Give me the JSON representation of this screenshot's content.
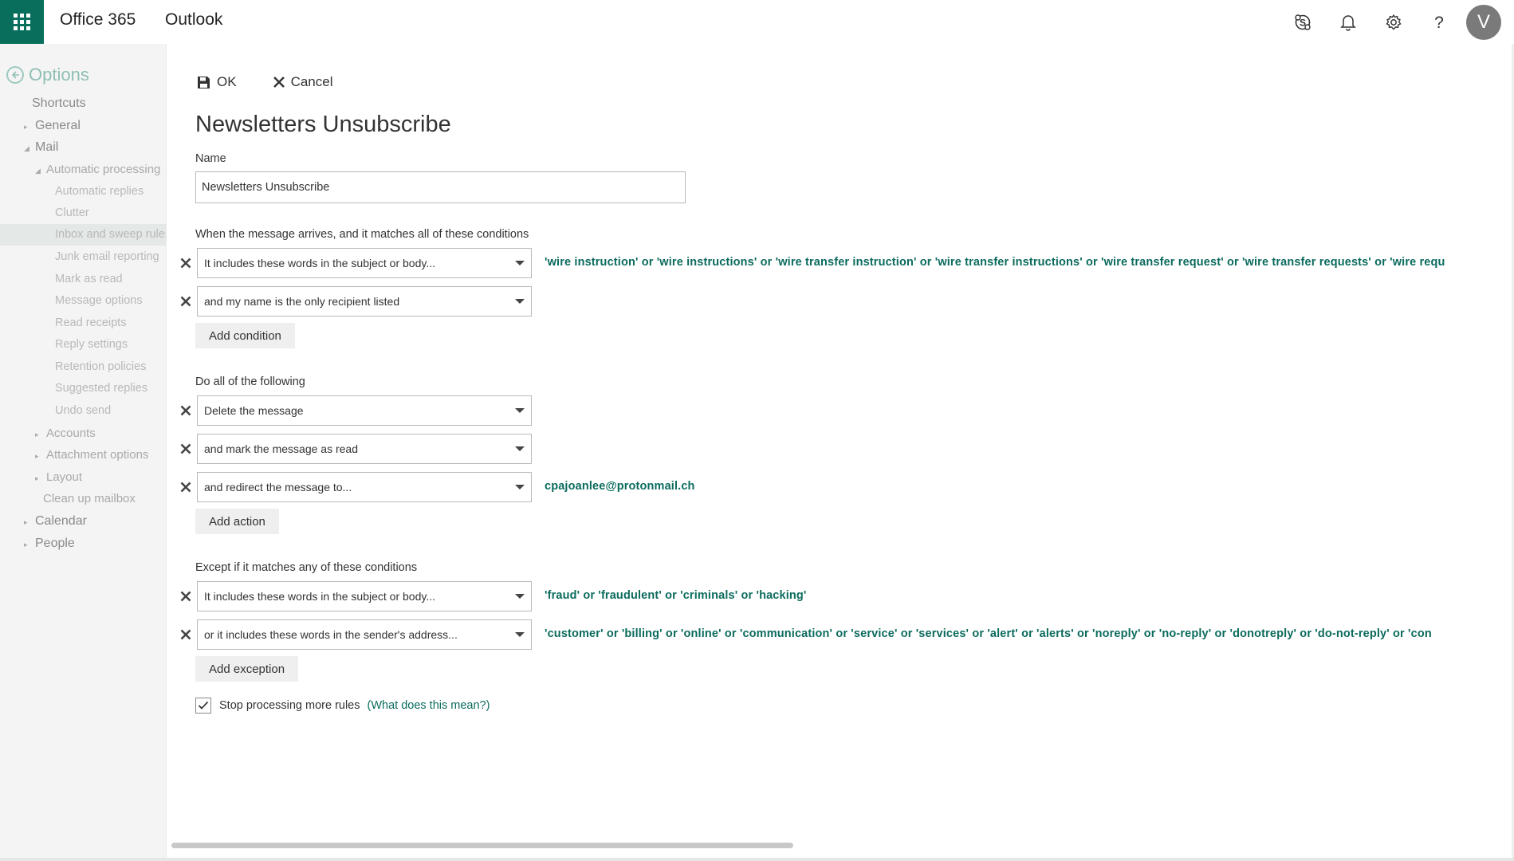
{
  "topbar": {
    "brand": "Office 365",
    "app": "Outlook",
    "avatar_initial": "V",
    "accent_color": "#0a6e5c",
    "icons": [
      "skype-icon",
      "bell-icon",
      "gear-icon",
      "help-icon"
    ]
  },
  "sidebar": {
    "title": "Options",
    "items": [
      {
        "label": "Shortcuts"
      },
      {
        "label": "General"
      },
      {
        "label": "Mail"
      },
      {
        "label": "Automatic processing"
      },
      {
        "label": "Automatic replies"
      },
      {
        "label": "Clutter"
      },
      {
        "label": "Inbox and sweep rules"
      },
      {
        "label": "Junk email reporting"
      },
      {
        "label": "Mark as read"
      },
      {
        "label": "Message options"
      },
      {
        "label": "Read receipts"
      },
      {
        "label": "Reply settings"
      },
      {
        "label": "Retention policies"
      },
      {
        "label": "Suggested replies"
      },
      {
        "label": "Undo send"
      },
      {
        "label": "Accounts"
      },
      {
        "label": "Attachment options"
      },
      {
        "label": "Layout"
      },
      {
        "label": "Clean up mailbox"
      },
      {
        "label": "Calendar"
      },
      {
        "label": "People"
      }
    ]
  },
  "toolbar": {
    "ok_label": "OK",
    "cancel_label": "Cancel"
  },
  "rule": {
    "title": "Newsletters Unsubscribe",
    "name_label": "Name",
    "name_value": "Newsletters Unsubscribe",
    "conditions_label": "When the message arrives, and it matches all of these conditions",
    "conditions": [
      {
        "dropdown": "It includes these words in the subject or body...",
        "value": "'wire instruction' or 'wire instructions' or 'wire transfer instruction' or 'wire transfer instructions' or 'wire transfer request' or 'wire transfer requests' or 'wire requ"
      },
      {
        "dropdown": "and my name is the only recipient listed",
        "value": ""
      }
    ],
    "add_condition_label": "Add condition",
    "actions_label": "Do all of the following",
    "actions": [
      {
        "dropdown": "Delete the message",
        "value": ""
      },
      {
        "dropdown": "and mark the message as read",
        "value": ""
      },
      {
        "dropdown": "and redirect the message to...",
        "value": "cpajoanlee@protonmail.ch"
      }
    ],
    "add_action_label": "Add action",
    "exceptions_label": "Except if it matches any of these conditions",
    "exceptions": [
      {
        "dropdown": "It includes these words in the subject or body...",
        "value": "'fraud' or 'fraudulent' or 'criminals' or 'hacking'"
      },
      {
        "dropdown": "or it includes these words in the sender's address...",
        "value": "'customer' or 'billing' or 'online' or 'communication' or 'service' or 'services' or 'alert' or 'alerts' or 'noreply' or 'no-reply' or 'donotreply' or 'do-not-reply' or 'con"
      }
    ],
    "add_exception_label": "Add exception",
    "stop_processing_label": "Stop processing more rules",
    "stop_processing_checked": true,
    "help_link": "(What does this mean?)"
  }
}
